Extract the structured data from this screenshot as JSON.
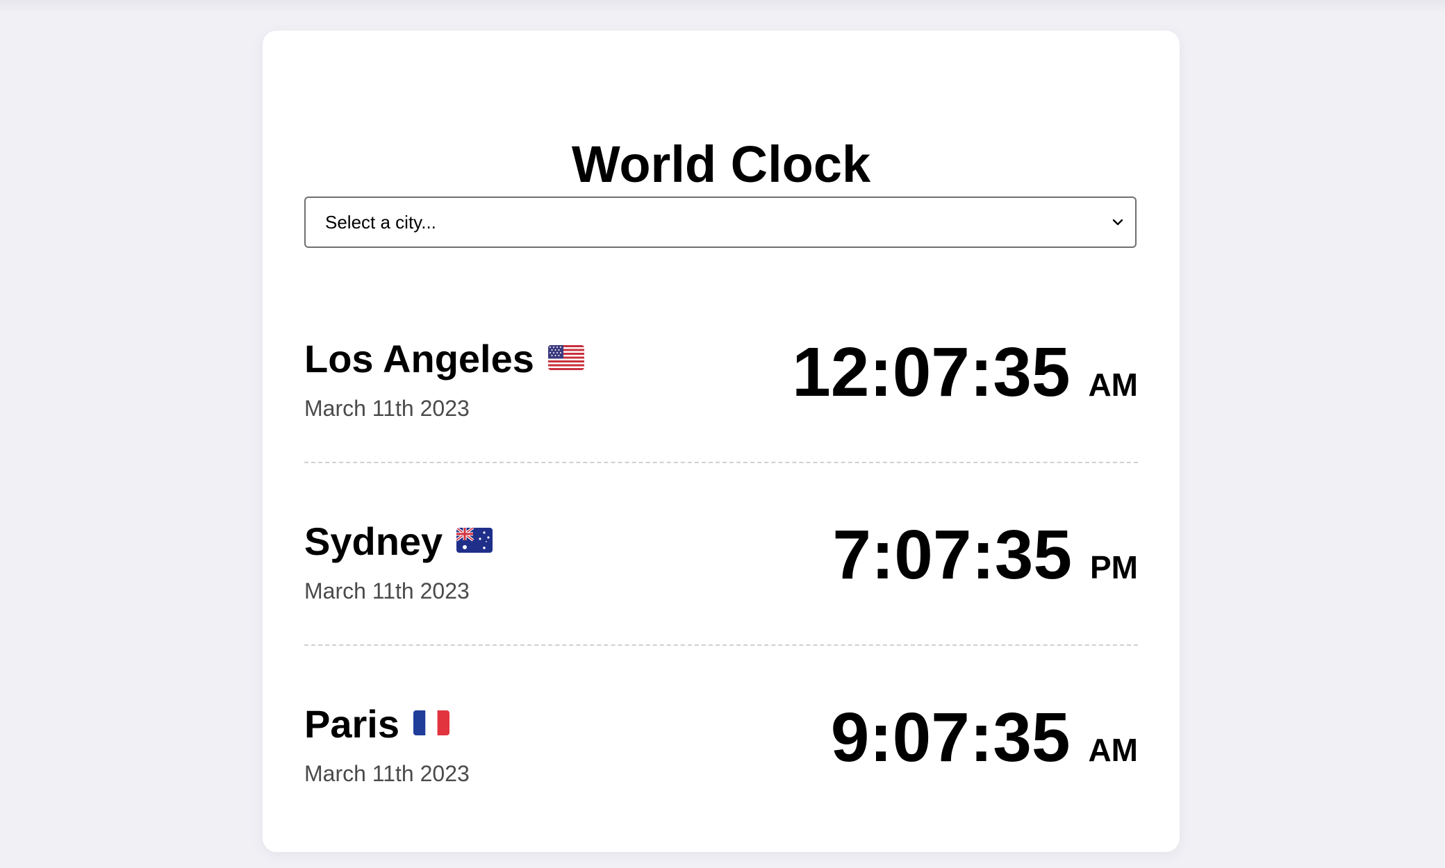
{
  "title": "World Clock",
  "select": {
    "value": "Select a city..."
  },
  "cities": [
    {
      "name": "Los Angeles",
      "flag": "us-flag-icon",
      "date": "March 11th 2023",
      "time": "12:07:35",
      "period": "AM"
    },
    {
      "name": "Sydney",
      "flag": "australia-flag-icon",
      "date": "March 11th 2023",
      "time": "7:07:35",
      "period": "PM"
    },
    {
      "name": "Paris",
      "flag": "france-flag-icon",
      "date": "March 11th 2023",
      "time": "9:07:35",
      "period": "AM"
    }
  ],
  "colors": {
    "background": "#f1f0f5",
    "card": "#ffffff",
    "text": "#000000",
    "date_text": "#4a4a4a",
    "divider": "#d0d0d0"
  }
}
